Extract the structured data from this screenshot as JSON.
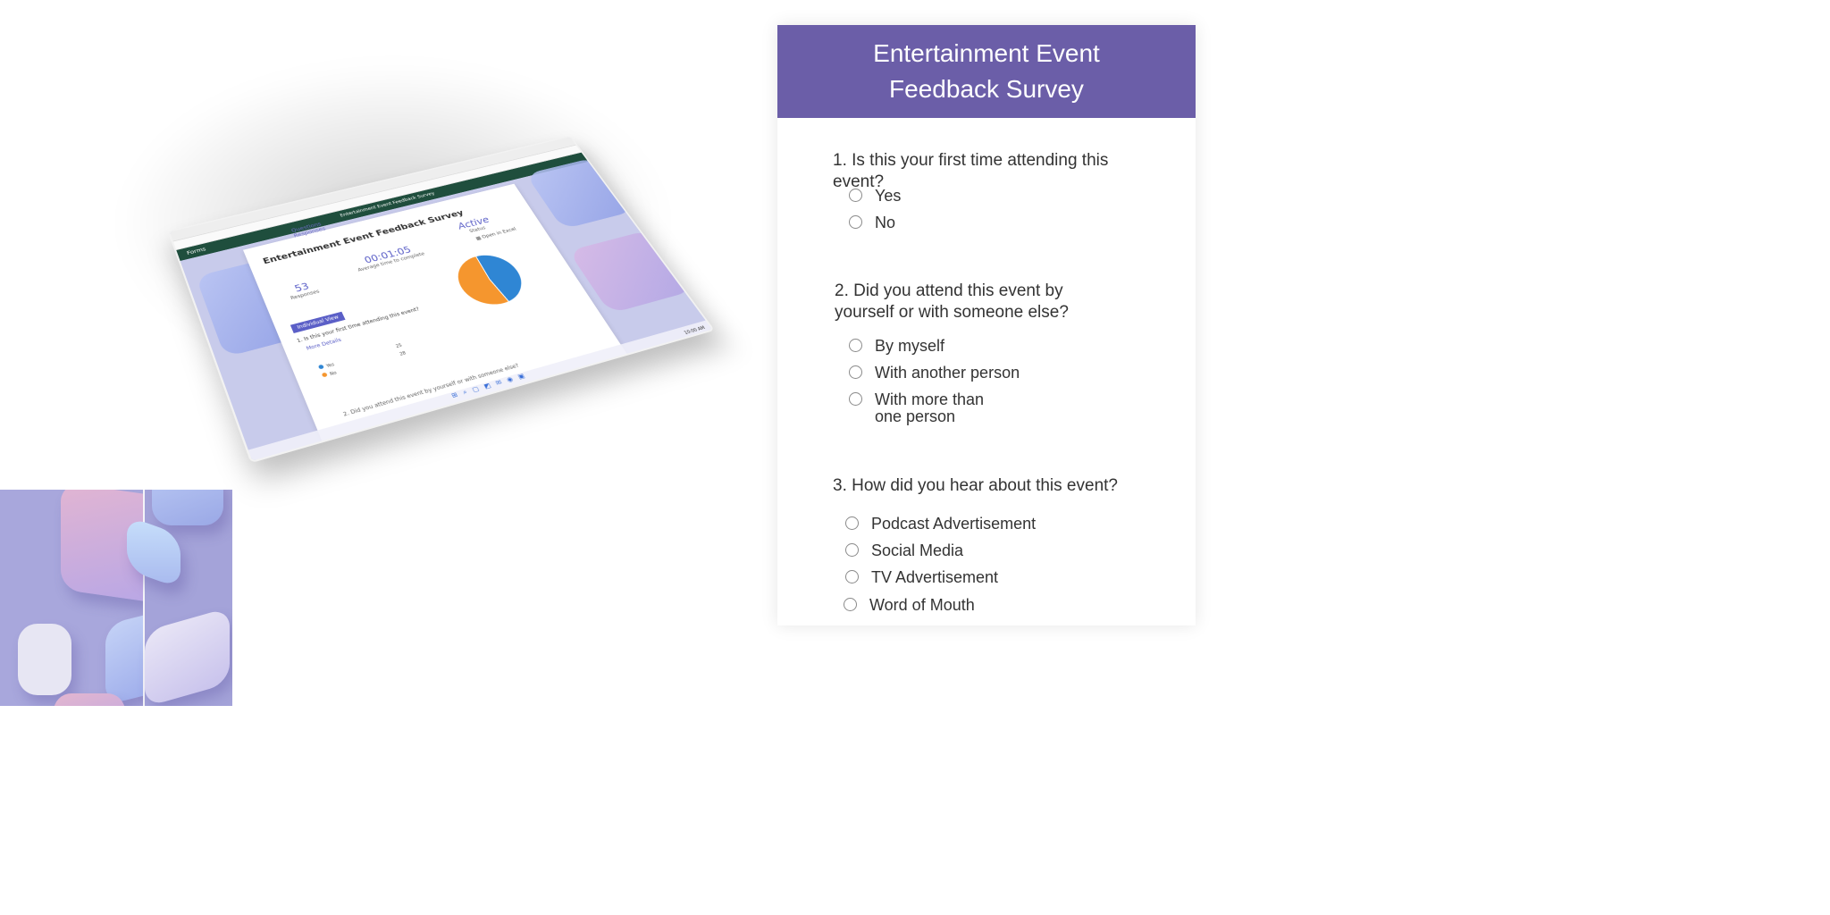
{
  "preview": {
    "forms_brand": "Forms",
    "header_title": "Entertainment Event Feedback Survey",
    "tab_questions": "Questions",
    "tab_responses": "Responses",
    "card_title": "Entertainment Event Feedback Survey",
    "responses_count": "53",
    "responses_label": "Responses",
    "avg_time": "00:01:05",
    "avg_time_label": "Average time to complete",
    "status_value": "Active",
    "status_label": "Status",
    "open_in_excel": "Open in Excel",
    "individual_view_label": "Individual View",
    "q1_text": "1. Is this your first time attending this event?",
    "more_details": "More Details",
    "legend": [
      {
        "label": "Yes",
        "count": "25",
        "color": "#2f86d4"
      },
      {
        "label": "No",
        "count": "28",
        "color": "#f5962e"
      }
    ],
    "q2_text": "2. Did you attend this event by yourself or with someone else?",
    "clock": "10:00 AM"
  },
  "survey": {
    "title": "Entertainment Event Feedback Survey",
    "header_color": "#6b5ea8",
    "questions": [
      {
        "text": "1. Is this your first time attending this event?",
        "options": [
          "Yes",
          "No"
        ]
      },
      {
        "text": "2. Did you attend this event by yourself or with someone else?",
        "options": [
          "By myself",
          "With another person",
          "With more than one person"
        ]
      },
      {
        "text": "3. How did you hear about this event?",
        "options": [
          "Podcast Advertisement",
          "Social Media",
          "TV Advertisement",
          "Word of Mouth"
        ]
      }
    ]
  }
}
